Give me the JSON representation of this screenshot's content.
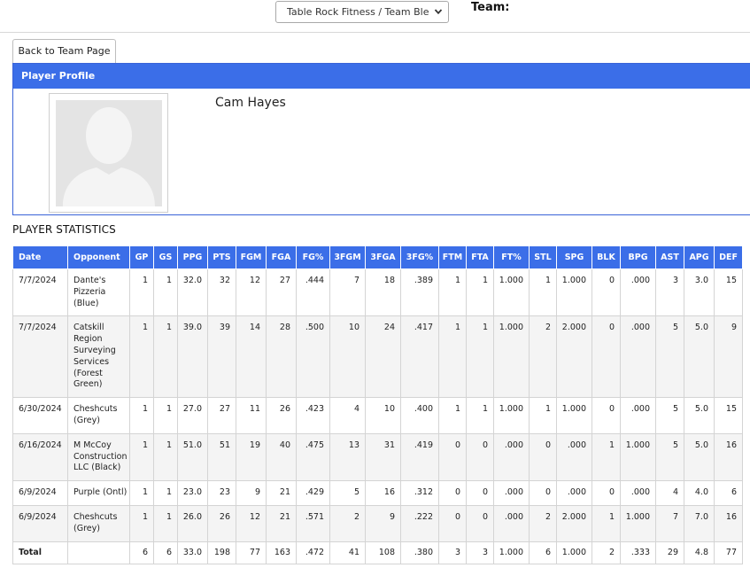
{
  "topbar": {
    "team_select_value": "Table Rock Fitness / Team Blend",
    "team_label": "Team:"
  },
  "back_button": "Back to Team Page",
  "profile": {
    "header": "Player Profile",
    "name": "Cam Hayes"
  },
  "stats_title": "PLAYER STATISTICS",
  "stats": {
    "columns": [
      "Date",
      "Opponent",
      "GP",
      "GS",
      "PPG",
      "PTS",
      "FGM",
      "FGA",
      "FG%",
      "3FGM",
      "3FGA",
      "3FG%",
      "FTM",
      "FTA",
      "FT%",
      "STL",
      "SPG",
      "BLK",
      "BPG",
      "AST",
      "APG",
      "DEF"
    ],
    "rows": [
      [
        "7/7/2024",
        "Dante's Pizzeria (Blue)",
        "1",
        "1",
        "32.0",
        "32",
        "12",
        "27",
        ".444",
        "7",
        "18",
        ".389",
        "1",
        "1",
        "1.000",
        "1",
        "1.000",
        "0",
        ".000",
        "3",
        "3.0",
        "15"
      ],
      [
        "7/7/2024",
        "Catskill Region Surveying Services (Forest Green)",
        "1",
        "1",
        "39.0",
        "39",
        "14",
        "28",
        ".500",
        "10",
        "24",
        ".417",
        "1",
        "1",
        "1.000",
        "2",
        "2.000",
        "0",
        ".000",
        "5",
        "5.0",
        "9"
      ],
      [
        "6/30/2024",
        "Cheshcuts (Grey)",
        "1",
        "1",
        "27.0",
        "27",
        "11",
        "26",
        ".423",
        "4",
        "10",
        ".400",
        "1",
        "1",
        "1.000",
        "1",
        "1.000",
        "0",
        ".000",
        "5",
        "5.0",
        "15"
      ],
      [
        "6/16/2024",
        "M McCoy Construction LLC (Black)",
        "1",
        "1",
        "51.0",
        "51",
        "19",
        "40",
        ".475",
        "13",
        "31",
        ".419",
        "0",
        "0",
        ".000",
        "0",
        ".000",
        "1",
        "1.000",
        "5",
        "5.0",
        "16"
      ],
      [
        "6/9/2024",
        "Purple (Ontl)",
        "1",
        "1",
        "23.0",
        "23",
        "9",
        "21",
        ".429",
        "5",
        "16",
        ".312",
        "0",
        "0",
        ".000",
        "0",
        ".000",
        "0",
        ".000",
        "4",
        "4.0",
        "6"
      ],
      [
        "6/9/2024",
        "Cheshcuts (Grey)",
        "1",
        "1",
        "26.0",
        "26",
        "12",
        "21",
        ".571",
        "2",
        "9",
        ".222",
        "0",
        "0",
        ".000",
        "2",
        "2.000",
        "1",
        "1.000",
        "7",
        "7.0",
        "16"
      ]
    ],
    "total": [
      "Total",
      "",
      "6",
      "6",
      "33.0",
      "198",
      "77",
      "163",
      ".472",
      "41",
      "108",
      ".380",
      "3",
      "3",
      "1.000",
      "6",
      "1.000",
      "2",
      ".333",
      "29",
      "4.8",
      "77"
    ]
  },
  "icons": {
    "avatar": "avatar-placeholder-icon",
    "select_caret": "chevron-down-icon"
  }
}
